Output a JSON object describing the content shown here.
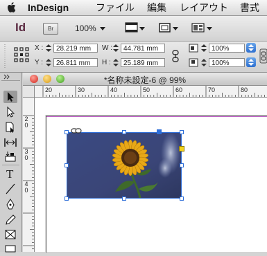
{
  "menubar": {
    "app_name": "InDesign",
    "items": [
      "ファイル",
      "編集",
      "レイアウト",
      "書式"
    ]
  },
  "appbar": {
    "logo": "Id",
    "bridge_label": "Br",
    "zoom": "100%"
  },
  "control": {
    "x_label": "X :",
    "x_value": "28.219 mm",
    "y_label": "Y :",
    "y_value": "26.811 mm",
    "w_label": "W :",
    "w_value": "44.781 mm",
    "h_label": "H :",
    "h_value": "25.189 mm",
    "scale_x": "100%",
    "scale_y": "100%"
  },
  "document": {
    "title": "*名称未設定-6 @ 99%",
    "hruler_labels": [
      "20",
      "30",
      "40",
      "50",
      "60",
      "70",
      "80"
    ],
    "vruler_labels": [
      "2\n0",
      "3\n0",
      "4\n0"
    ]
  },
  "colors": {
    "selection": "#2f6fd8",
    "sky": "#37457a",
    "petal": "#e8a817",
    "stem": "#3f6a2a"
  }
}
